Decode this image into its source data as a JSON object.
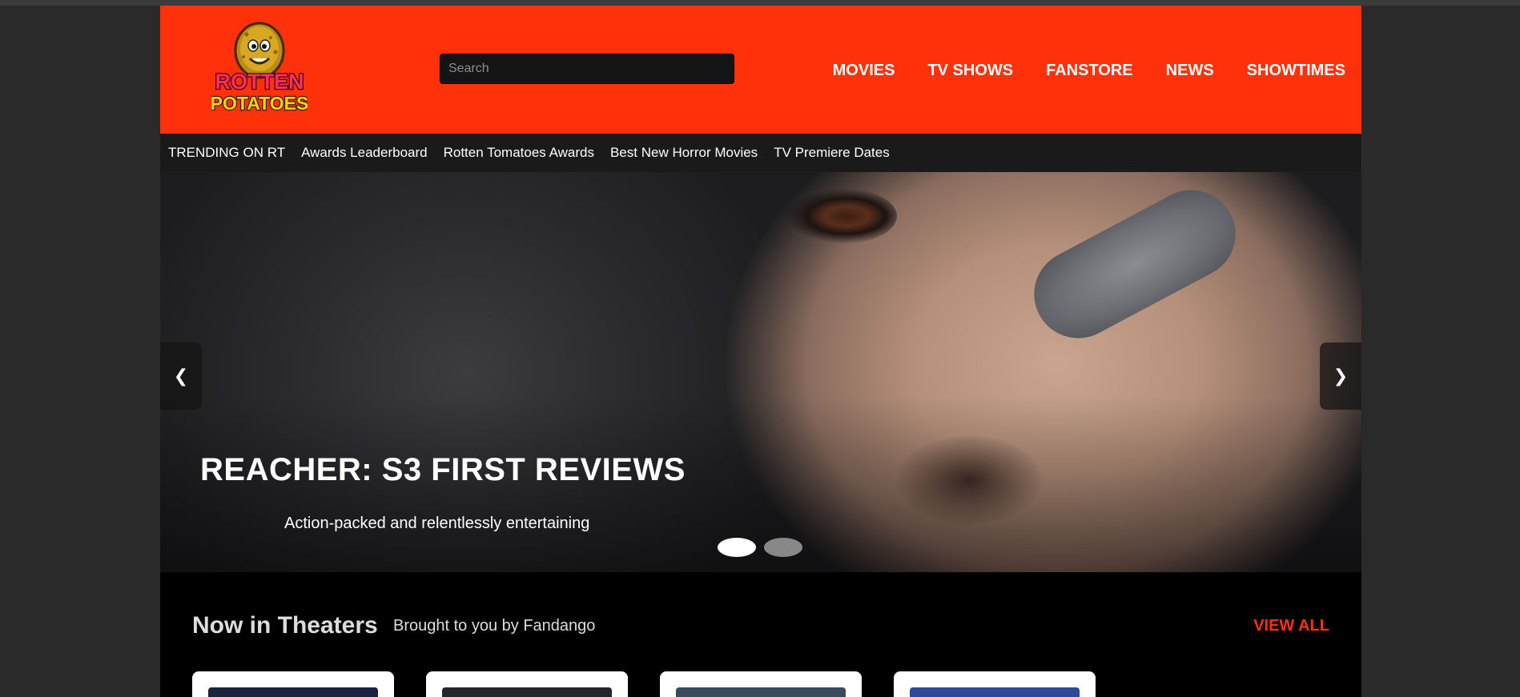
{
  "header": {
    "logo_line1": "ROTTEN",
    "logo_line2": "POTATOES",
    "search_placeholder": "Search",
    "nav": [
      {
        "label": "MOVIES"
      },
      {
        "label": "TV SHOWS"
      },
      {
        "label": "FANSTORE"
      },
      {
        "label": "NEWS"
      },
      {
        "label": "SHOWTIMES"
      }
    ],
    "brand_color": "#ff310b"
  },
  "trending": {
    "title": "TRENDING ON RT",
    "links": [
      {
        "label": "Awards Leaderboard"
      },
      {
        "label": "Rotten Tomatoes Awards"
      },
      {
        "label": "Best New Horror Movies"
      },
      {
        "label": "TV Premiere Dates"
      }
    ]
  },
  "hero": {
    "title": "REACHER: S3 FIRST REVIEWS",
    "subtitle": "Action-packed and relentlessly entertaining",
    "prev_icon": "chevron-left-icon",
    "next_icon": "chevron-right-icon",
    "prev_glyph": "❮",
    "next_glyph": "❯",
    "slide_count": 2,
    "active_slide": 1
  },
  "theaters": {
    "title": "Now in Theaters",
    "subtitle": "Brought to you by Fandango",
    "view_all": "VIEW ALL",
    "cards": [
      {
        "poster_color": "#1b2340"
      },
      {
        "poster_color": "#23262b"
      },
      {
        "poster_color": "#3a4a5e"
      },
      {
        "poster_color": "#2f4a9c"
      }
    ]
  }
}
